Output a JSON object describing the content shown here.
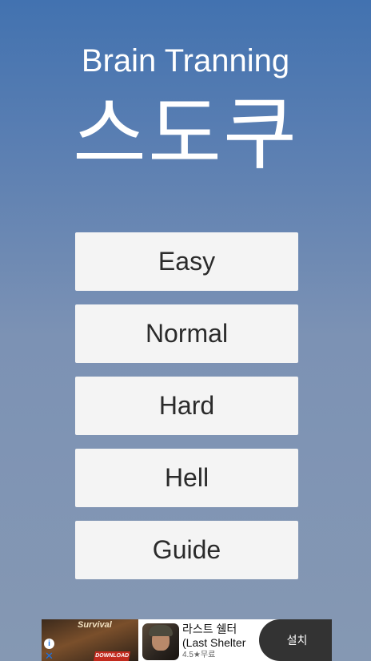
{
  "header": {
    "subtitle": "Brain Tranning",
    "title": "스도쿠"
  },
  "menu": {
    "items": [
      {
        "label": "Easy"
      },
      {
        "label": "Normal"
      },
      {
        "label": "Hard"
      },
      {
        "label": "Hell"
      },
      {
        "label": "Guide"
      }
    ]
  },
  "ad": {
    "image_title": "Survival",
    "image_button": "DOWNLOAD",
    "app_name_line1": "라스트 쉘터",
    "app_name_line2": "(Last Shelter",
    "rating": "4.5★무료",
    "install_label": "설치",
    "info_icon": "info-icon",
    "close_icon": "close-icon"
  },
  "colors": {
    "background_top": "#4272b0",
    "background_bottom": "#8598b3",
    "button_bg": "#f4f4f4",
    "button_text": "#2b2b2b",
    "install_bg": "#333333"
  }
}
